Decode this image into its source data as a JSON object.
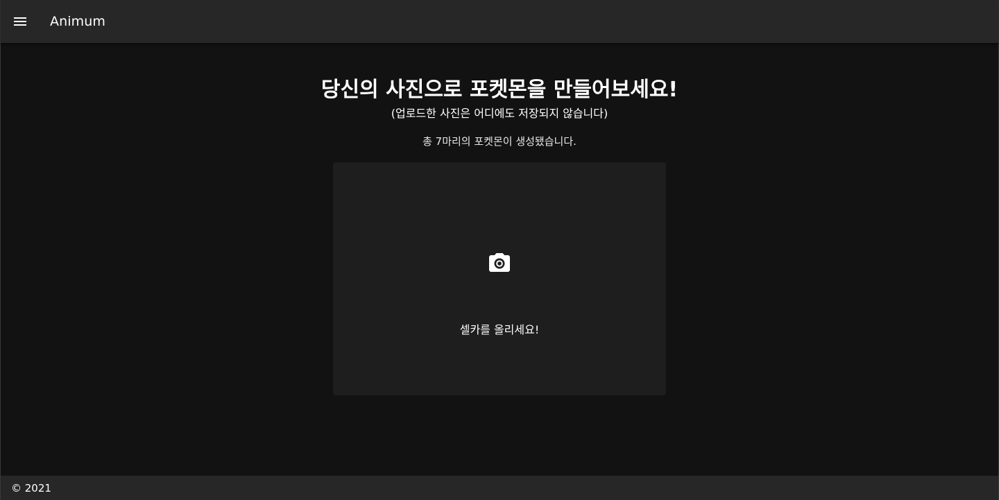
{
  "app_bar": {
    "menu_icon": "menu-icon",
    "title": "Animum"
  },
  "main": {
    "headline": "당신의 사진으로 포켓몬을 만들어보세요!",
    "subnote": "(업로드한 사진은 어디에도 저장되지 않습니다)",
    "count_text": "총 7마리의 포켓몬이 생성됐습니다.",
    "upload": {
      "icon": "camera-icon",
      "label": "셀카를 올리세요!"
    }
  },
  "footer": {
    "copyright": "© 2021"
  },
  "colors": {
    "background": "#121212",
    "app_bar": "#272727",
    "card": "#1e1e1e",
    "text": "#ffffff"
  }
}
